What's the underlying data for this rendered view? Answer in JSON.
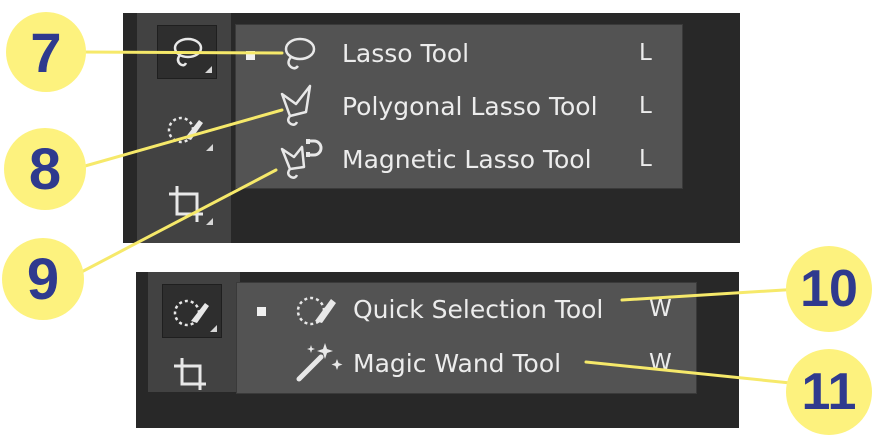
{
  "lasso_menu": {
    "items": [
      {
        "label": "Lasso Tool",
        "key": "L",
        "icon": "lasso-icon",
        "selected": true
      },
      {
        "label": "Polygonal Lasso Tool",
        "key": "L",
        "icon": "polygonal-lasso-icon",
        "selected": false
      },
      {
        "label": "Magnetic Lasso Tool",
        "key": "L",
        "icon": "magnetic-lasso-icon",
        "selected": false
      }
    ]
  },
  "selection_menu": {
    "items": [
      {
        "label": "Quick Selection Tool",
        "key": "W",
        "icon": "quick-selection-icon",
        "selected": true
      },
      {
        "label": "Magic Wand Tool",
        "key": "W",
        "icon": "magic-wand-icon",
        "selected": false
      }
    ]
  },
  "callouts": [
    "7",
    "8",
    "9",
    "10",
    "11"
  ],
  "colors": {
    "callout_fill": "#fdf27e",
    "callout_text": "#2f3a8e",
    "menu_bg": "#535353",
    "toolbar_bg": "#424242",
    "panel_bg": "#282828"
  }
}
